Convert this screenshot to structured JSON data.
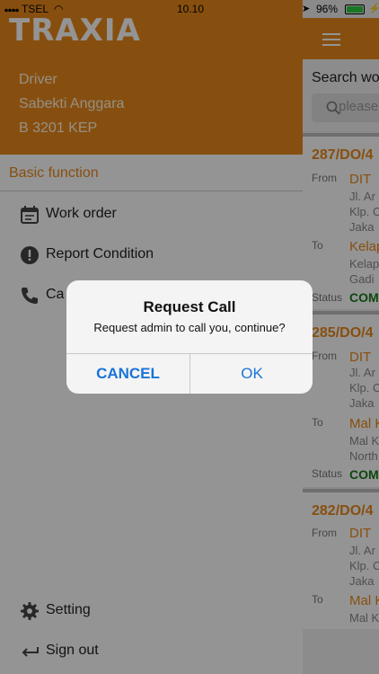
{
  "status_bar": {
    "carrier": "TSEL",
    "time": "10.10",
    "battery": "96%"
  },
  "drawer": {
    "brand": "TRAXIA",
    "driver_label": "Driver",
    "driver_name": "Sabekti Anggara",
    "plate": "B 3201 KEP",
    "section_title": "Basic function",
    "items": [
      {
        "label": "Work order"
      },
      {
        "label": "Report Condition"
      },
      {
        "label": "Ca"
      }
    ],
    "setting_label": "Setting",
    "signout_label": "Sign out"
  },
  "main": {
    "search_title": "Search wo",
    "search_placeholder": "please",
    "orders": [
      {
        "code": "287/DO/4",
        "from_label": "From",
        "from_loc": "DIT",
        "from_addr": [
          "Jl. Ar",
          "Klp. C",
          "Jaka"
        ],
        "to_label": "To",
        "to_loc": "Kelap",
        "to_addr": [
          "Kelap",
          "Gadi"
        ],
        "status_label": "Status",
        "status": "COM"
      },
      {
        "code": "285/DO/4",
        "from_label": "From",
        "from_loc": "DIT",
        "from_addr": [
          "Jl. Ar",
          "Klp. C",
          "Jaka"
        ],
        "to_label": "To",
        "to_loc": "Mal K",
        "to_addr": [
          "Mal K",
          "North"
        ],
        "status_label": "Status",
        "status": "COM"
      },
      {
        "code": "282/DO/4",
        "from_label": "From",
        "from_loc": "DIT",
        "from_addr": [
          "Jl. Ar",
          "Klp. C",
          "Jaka"
        ],
        "to_label": "To",
        "to_loc": "Mal K",
        "to_addr": [
          "Mal K"
        ]
      }
    ]
  },
  "dialog": {
    "title": "Request Call",
    "message": "Request admin to call you, continue?",
    "cancel_label": "CANCEL",
    "ok_label": "OK"
  },
  "colors": {
    "accent": "#E8891A",
    "status_ok": "#1a7a1a",
    "dialog_button": "#1a73d8"
  }
}
